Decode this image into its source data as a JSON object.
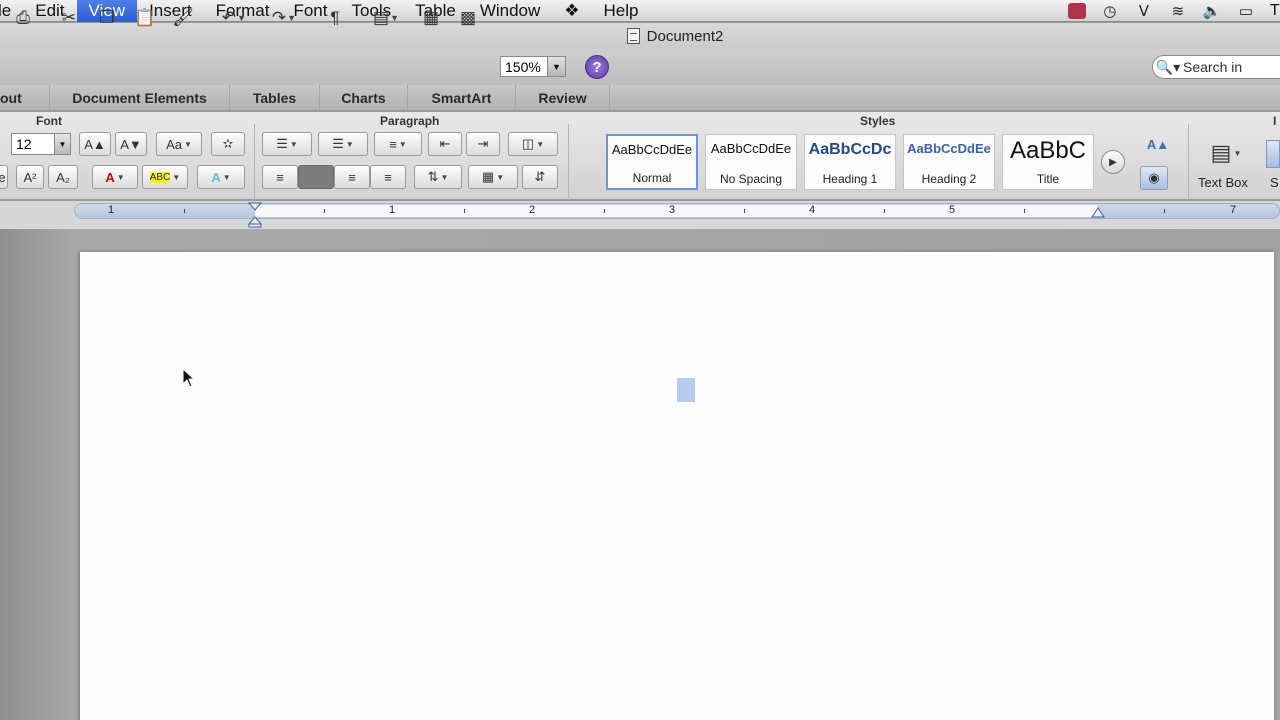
{
  "menubar": {
    "items": [
      "le",
      "Edit",
      "View",
      "Insert",
      "Format",
      "Font",
      "Tools",
      "Table",
      "Window",
      "Help"
    ],
    "active": "View",
    "clock": "Tu"
  },
  "window": {
    "title": "Document2"
  },
  "toolbar": {
    "zoom": "150%",
    "search_placeholder": "Search in"
  },
  "ribbon_tabs": [
    "out",
    "Document Elements",
    "Tables",
    "Charts",
    "SmartArt",
    "Review"
  ],
  "ribbon": {
    "font_group": "Font",
    "font_size": "12",
    "paragraph_group": "Paragraph",
    "styles_group": "Styles",
    "styles": [
      {
        "sample": "AaBbCcDdEe",
        "name": "Normal"
      },
      {
        "sample": "AaBbCcDdEe",
        "name": "No Spacing"
      },
      {
        "sample": "AaBbCcDc",
        "name": "Heading 1"
      },
      {
        "sample": "AaBbCcDdEe",
        "name": "Heading 2"
      },
      {
        "sample": "AaBbC",
        "name": "Title"
      }
    ],
    "insert_group": "I",
    "text_box": "Text Box",
    "shape_label": "S"
  },
  "ruler": {
    "numbers": [
      "1",
      "1",
      "2",
      "3",
      "4",
      "5",
      "7"
    ]
  }
}
